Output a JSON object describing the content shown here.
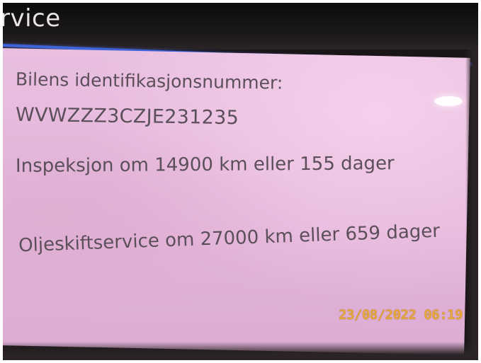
{
  "header": {
    "title": "rvice"
  },
  "content": {
    "vin_label": "Bilens identifikasjonsnummer:",
    "vin_value": "WVWZZZ3CZJE231235",
    "inspection": "Inspeksjon om 14900 km eller 155 dager",
    "oil_service": "Oljeskiftservice om 27000 km eller 659 dager"
  },
  "overlay": {
    "timestamp": "23/08/2022  06:19"
  },
  "colors": {
    "header_bg": "#111012",
    "accent_line": "#3f63d8",
    "panel_bg": "#e4b6da",
    "text": "#5b4f59",
    "timestamp": "#e7a83a"
  }
}
